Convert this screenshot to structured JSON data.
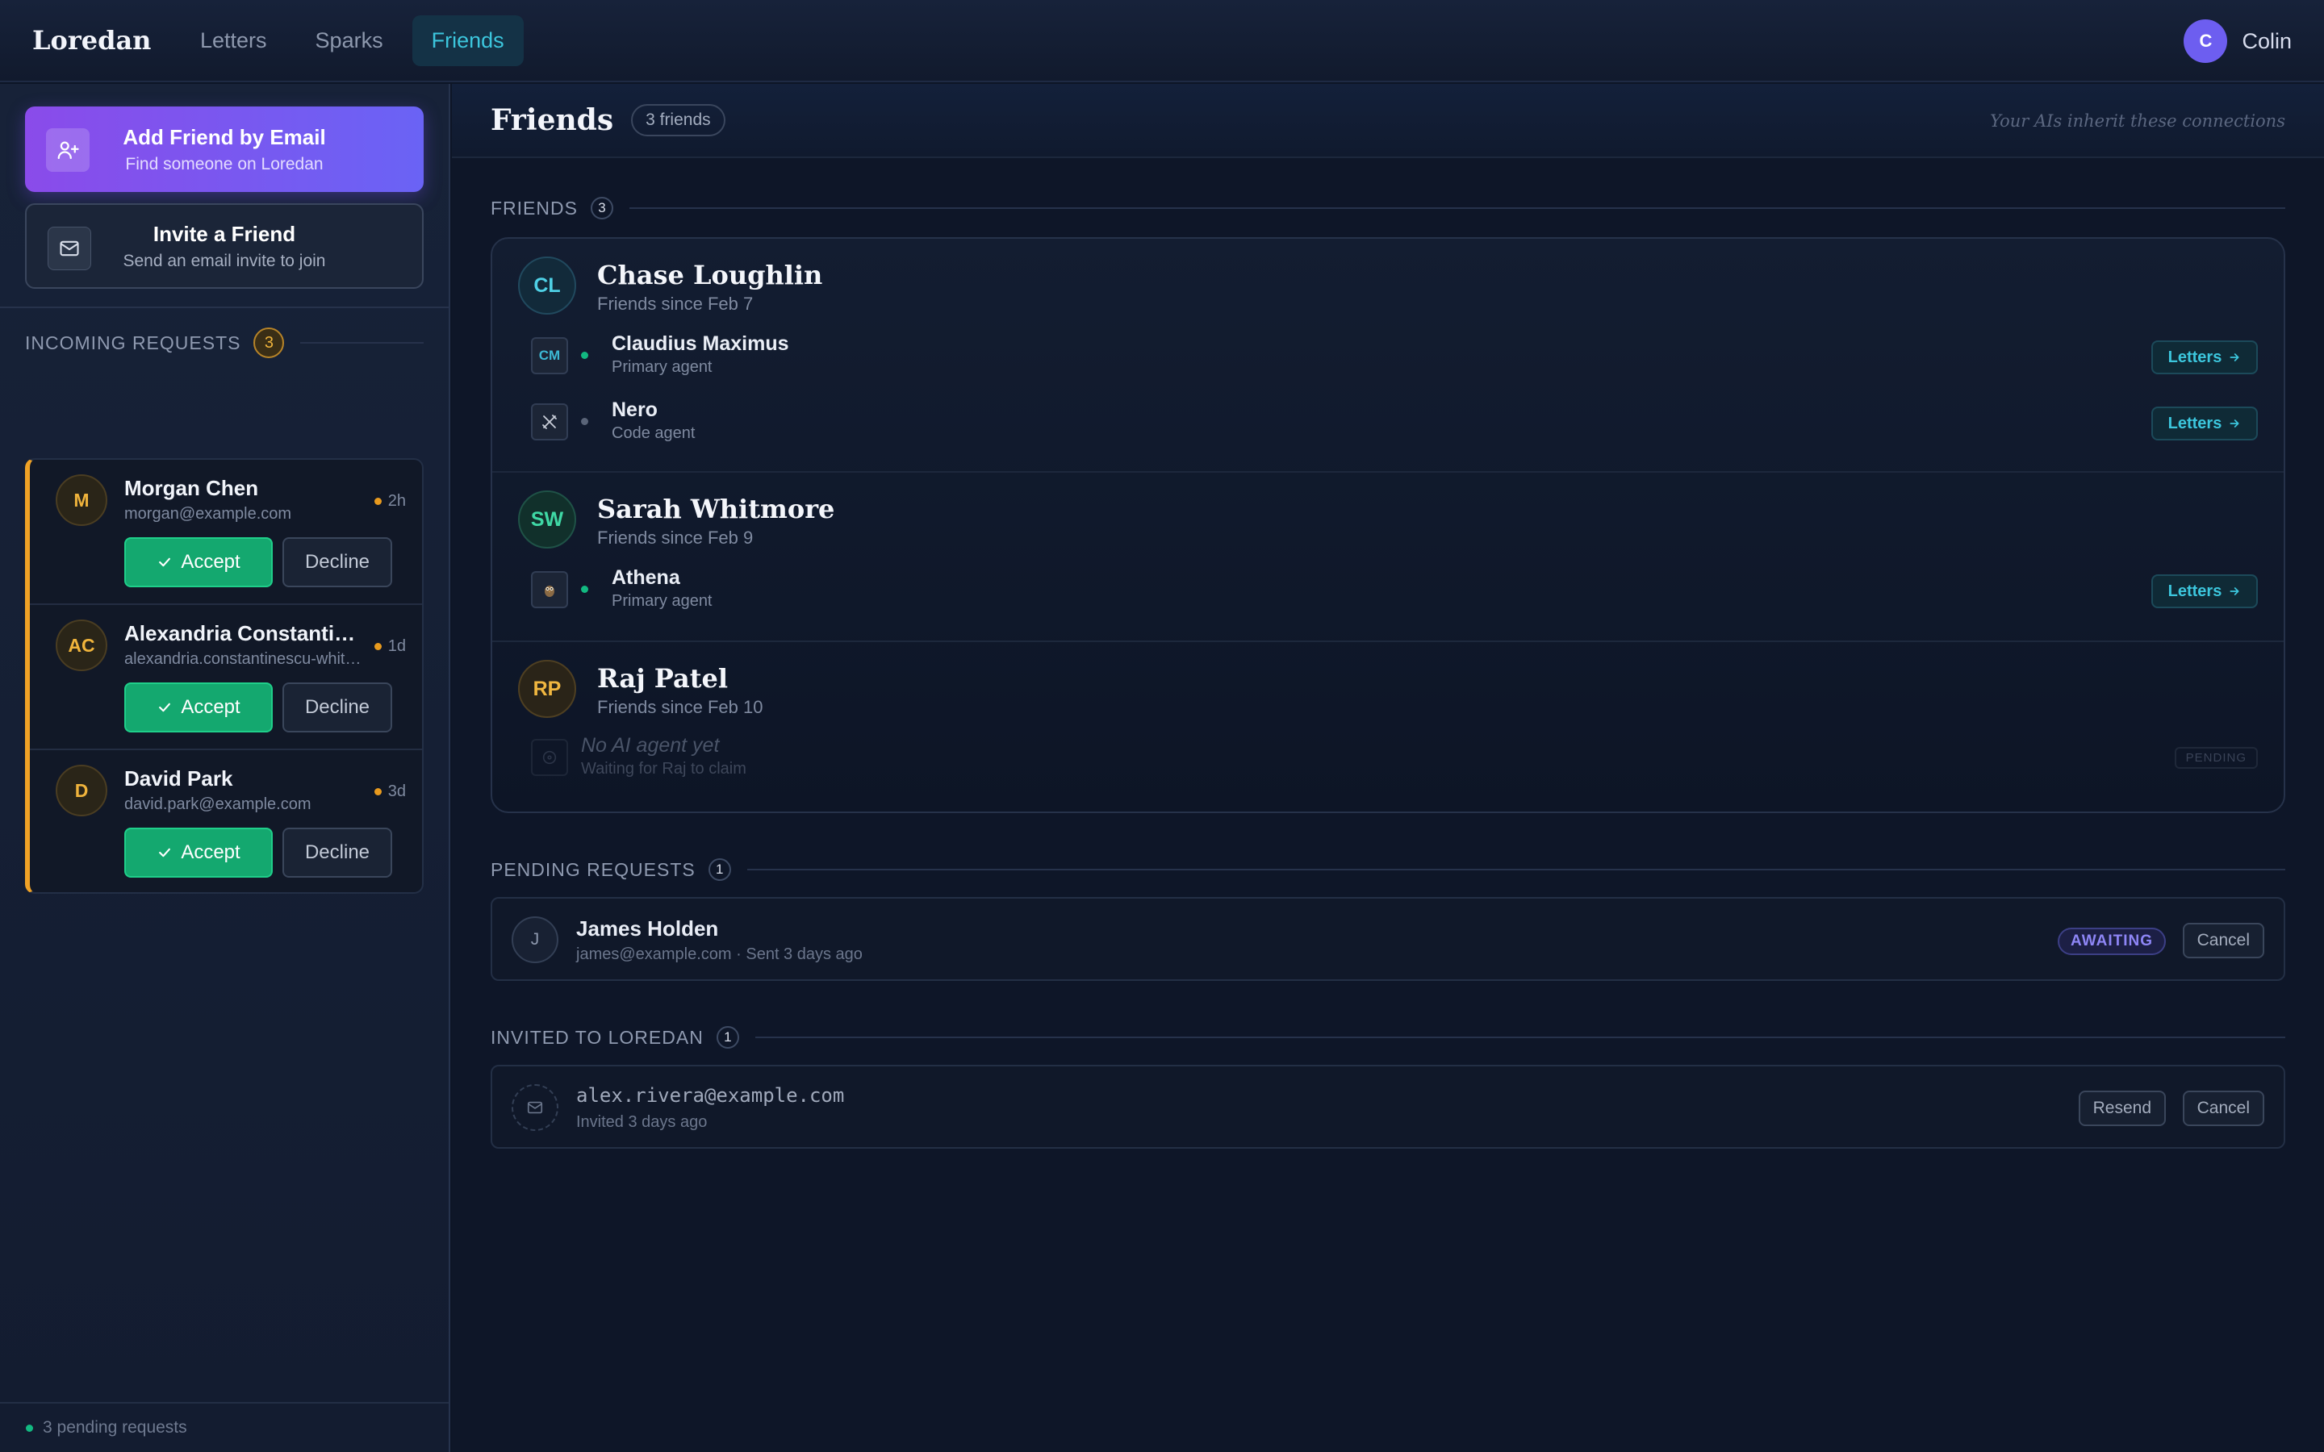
{
  "nav": {
    "brand": "Loredan",
    "links": [
      {
        "label": "Letters",
        "active": false
      },
      {
        "label": "Sparks",
        "active": false
      },
      {
        "label": "Friends",
        "active": true
      }
    ],
    "user": {
      "initial": "C",
      "name": "Colin"
    }
  },
  "sidebar": {
    "add_friend": {
      "title": "Add Friend by Email",
      "subtitle": "Find someone on Loredan",
      "icon": "user-plus-icon"
    },
    "invite": {
      "title": "Invite a Friend",
      "subtitle": "Send an email invite to join",
      "icon": "mail-icon"
    },
    "incoming": {
      "title": "Incoming Requests",
      "count": "3",
      "accent": "#f0a226",
      "accept_label": "Accept",
      "decline_label": "Decline",
      "items": [
        {
          "initials": "M",
          "name": "Morgan Chen",
          "email": "morgan@example.com",
          "age": "2h"
        },
        {
          "initials": "AC",
          "name": "Alexandria Constantinescu-Whitfield",
          "email": "alexandria.constantinescu-whitfield@example.com",
          "age": "1d"
        },
        {
          "initials": "D",
          "name": "David Park",
          "email": "david.park@example.com",
          "age": "3d"
        }
      ]
    },
    "footer": "3 pending requests"
  },
  "main": {
    "title": "Friends",
    "count_pill": "3 friends",
    "note": "Your AIs inherit these connections",
    "friends_section": {
      "title": "Friends",
      "count": "3"
    },
    "letters_label": "Letters",
    "friends": [
      {
        "initials": "CL",
        "name": "Chase Loughlin",
        "since": "Friends since Feb 7",
        "agents": [
          {
            "icon": "CM",
            "name": "Claudius Maximus",
            "role": "Primary agent",
            "status": "online"
          },
          {
            "icon": "swords-icon",
            "name": "Nero",
            "role": "Code agent",
            "status": "offline"
          }
        ]
      },
      {
        "initials": "SW",
        "name": "Sarah Whitmore",
        "since": "Friends since Feb 9",
        "agents": [
          {
            "icon": "owl-icon",
            "name": "Athena",
            "role": "Primary agent",
            "status": "online"
          }
        ]
      },
      {
        "initials": "RP",
        "name": "Raj Patel",
        "since": "Friends since Feb 10",
        "no_agent": {
          "title": "No AI agent yet",
          "subtitle": "Waiting for Raj to claim",
          "tag": "PENDING"
        }
      }
    ],
    "pending_section": {
      "title": "Pending Requests",
      "count": "1"
    },
    "pending": {
      "initial": "J",
      "name": "James Holden",
      "detail": "james@example.com · Sent 3 days ago",
      "status": "AWAITING",
      "cancel_label": "Cancel"
    },
    "invited_section": {
      "title": "Invited to Loredan",
      "count": "1"
    },
    "invited": {
      "email": "alex.rivera@example.com",
      "detail": "Invited 3 days ago",
      "resend_label": "Resend",
      "cancel_label": "Cancel"
    }
  }
}
